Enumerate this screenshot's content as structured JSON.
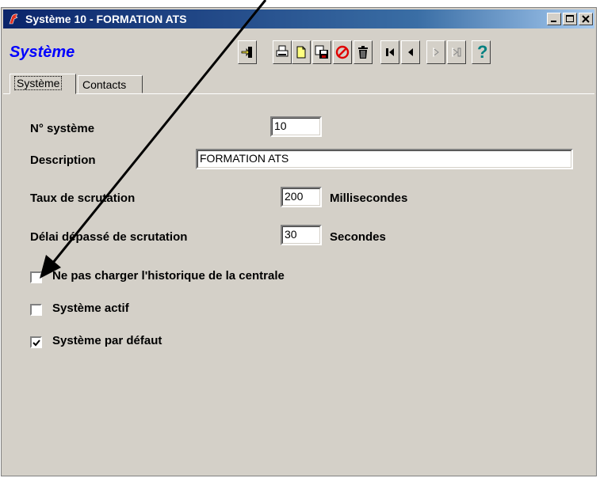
{
  "window": {
    "title": "Système 10 - FORMATION ATS"
  },
  "module_title": "Système",
  "tabs": [
    {
      "label": "Système",
      "active": true
    },
    {
      "label": "Contacts",
      "active": false
    }
  ],
  "fields": {
    "numero": {
      "label": "N° système",
      "value": "10"
    },
    "description": {
      "label": "Description",
      "value": "FORMATION ATS"
    },
    "taux": {
      "label": "Taux de scrutation",
      "value": "200",
      "unit": "Millisecondes"
    },
    "delai": {
      "label": "Délai dépassé de scrutation",
      "value": "30",
      "unit": "Secondes"
    }
  },
  "checkboxes": [
    {
      "label": "Ne pas charger l'historique de la centrale",
      "checked": false
    },
    {
      "label": "Système actif",
      "checked": false
    },
    {
      "label": "Système par défaut",
      "checked": true
    }
  ],
  "colors": {
    "title_gradient_start": "#0a246a",
    "module_title": "#0000ff",
    "dialog_bg": "#d4d0c8"
  },
  "icons": [
    "app-icon",
    "minimize-icon",
    "maximize-icon",
    "close-icon",
    "exit-icon",
    "print-icon",
    "new-icon",
    "save-icon",
    "cancel-icon",
    "delete-icon",
    "first-icon",
    "previous-icon",
    "next-icon",
    "last-icon",
    "help-icon"
  ]
}
